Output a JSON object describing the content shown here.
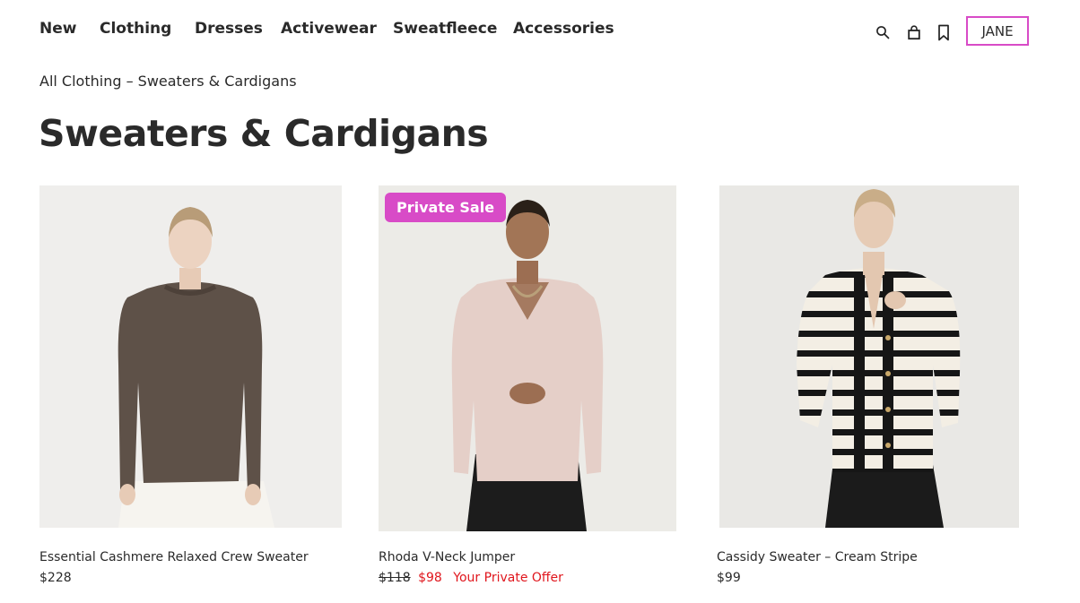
{
  "nav": {
    "items": [
      {
        "label": "New"
      },
      {
        "label": "Clothing"
      },
      {
        "label": "Dresses"
      },
      {
        "label": "Activewear"
      },
      {
        "label": "Sweatfleece"
      },
      {
        "label": "Accessories"
      }
    ]
  },
  "header": {
    "icons": [
      "search-icon",
      "bag-icon",
      "bookmark-icon"
    ],
    "account_label": "JANE",
    "accent_color": "#d84bc7"
  },
  "breadcrumb": {
    "parent": "All Clothing",
    "separator": " – ",
    "current": "Sweaters & Cardigans"
  },
  "page": {
    "title": "Sweaters & Cardigans"
  },
  "products": [
    {
      "name": "Essential Cashmere Relaxed Crew Sweater",
      "price": "$228"
    },
    {
      "badge": "Private Sale",
      "name": "Rhoda V-Neck Jumper",
      "old_price": "$118",
      "sale_price": "$98",
      "offer_label": "Your Private Offer"
    },
    {
      "name": "Cassidy Sweater – Cream Stripe",
      "price": "$99"
    }
  ],
  "colors": {
    "sale_red": "#e0161d",
    "badge_bg": "#d84bc7"
  }
}
